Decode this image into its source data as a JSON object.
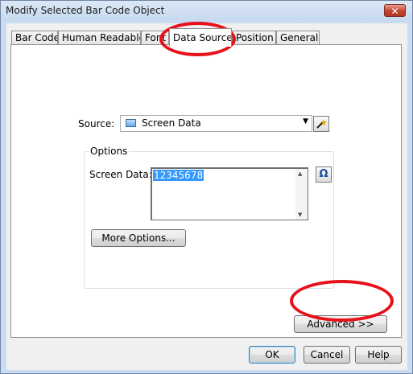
{
  "window": {
    "title": "Modify Selected Bar Code Object",
    "close_glyph": "✕"
  },
  "tabs": [
    {
      "label": "Bar Code"
    },
    {
      "label": "Human Readable"
    },
    {
      "label": "Font"
    },
    {
      "label": "Data Source",
      "active": true
    },
    {
      "label": "Position"
    },
    {
      "label": "General"
    }
  ],
  "source": {
    "label": "Source:",
    "value": "Screen Data",
    "icon": "screen-data-icon",
    "wizard_icon": "wand-icon"
  },
  "options": {
    "title": "Options",
    "screen_data_label": "Screen Data:",
    "screen_data_value": "12345678",
    "special_char_icon": "omega-icon",
    "special_char_glyph": "Ω",
    "more_options_label": "More Options..."
  },
  "advanced_label": "Advanced >>",
  "footer": {
    "ok": "OK",
    "cancel": "Cancel",
    "help": "Help"
  },
  "colors": {
    "highlight_ring": "#e8101a",
    "selection": "#3399ff"
  }
}
